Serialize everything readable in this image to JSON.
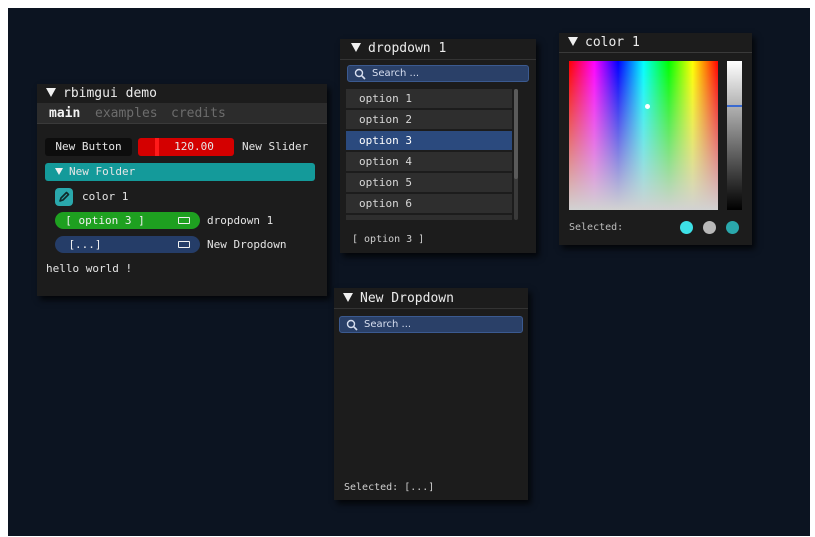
{
  "demo": {
    "title": "rbimgui demo",
    "tabs": [
      "main",
      "examples",
      "credits"
    ],
    "button_label": "New Button",
    "slider_value": "120.00",
    "slider_label": "New Slider",
    "folder_label": "New Folder",
    "color_label": "color 1",
    "dropdown1_value": "[ option 3 ]",
    "dropdown1_label": "dropdown 1",
    "dropdown2_value": "[...]",
    "dropdown2_label": "New Dropdown",
    "hello_text": "hello world !"
  },
  "dropdown1_window": {
    "title": "dropdown 1",
    "search_placeholder": "Search ...",
    "options": [
      "option 1",
      "option 2",
      "option 3",
      "option 4",
      "option 5",
      "option 6"
    ],
    "selected_index": 2,
    "footer": "[ option 3 ]"
  },
  "color_window": {
    "title": "color 1",
    "selected_label": "Selected:",
    "swatches": [
      "#3de0e6",
      "#b8b8b8",
      "#2aa8ac"
    ]
  },
  "new_dropdown_window": {
    "title": "New Dropdown",
    "search_placeholder": "Search ...",
    "footer": "Selected: [...]"
  },
  "colors": {
    "background": "#0c1421",
    "accent_teal": "#149a9a",
    "slider_red": "#d40000",
    "option_green": "#1ea020",
    "dropdown_blue": "#253d68",
    "selected_option": "#2b4a7e"
  }
}
